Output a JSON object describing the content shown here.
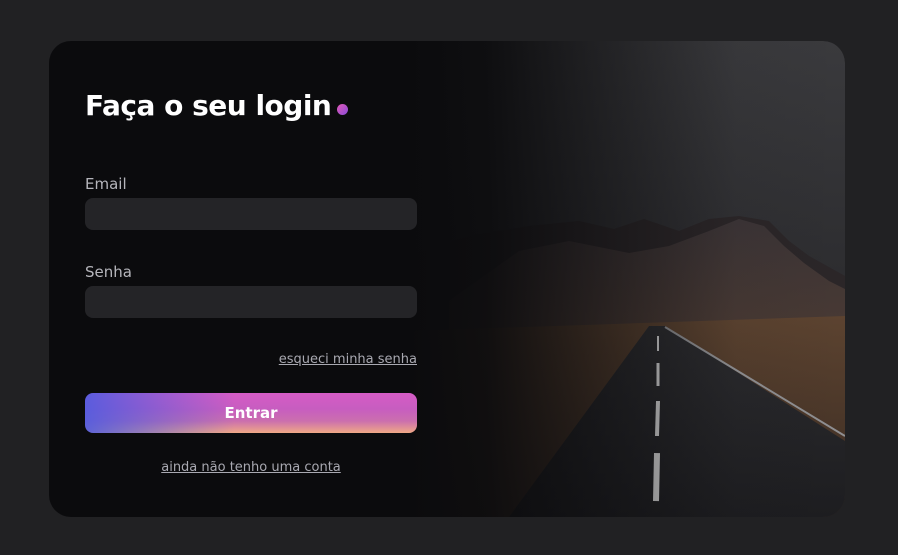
{
  "login": {
    "title": "Faça o seu login",
    "email_label": "Email",
    "email_value": "",
    "password_label": "Senha",
    "password_value": "",
    "forgot_password_link": "esqueci minha senha",
    "submit_label": "Entrar",
    "signup_link": "ainda não tenho uma conta"
  },
  "colors": {
    "background": "#212123",
    "card": "#0b0b0d",
    "input": "#242427",
    "accent_gradient": [
      "#5a5ce0",
      "#d65cc6",
      "#f7b87e"
    ]
  },
  "icons": {
    "title_dot": "gradient-dot-icon"
  },
  "image": {
    "subject": "road-through-mountains-photo"
  }
}
